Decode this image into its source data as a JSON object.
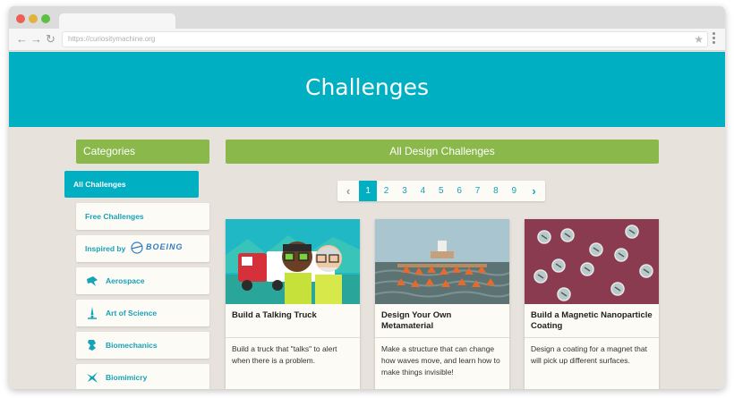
{
  "browser": {
    "url": "https://curiositymachine.org"
  },
  "header": {
    "title": "Challenges"
  },
  "sidebar": {
    "heading": "Categories",
    "items": [
      {
        "label": "All Challenges",
        "active": true,
        "icon": "none"
      },
      {
        "label": "Free Challenges",
        "active": false,
        "icon": "none"
      },
      {
        "label": "Inspired by",
        "active": false,
        "icon": "boeing-logo",
        "logo_text": "BOEING"
      },
      {
        "label": "Aerospace",
        "active": false,
        "icon": "aerospace-icon"
      },
      {
        "label": "Art of Science",
        "active": false,
        "icon": "art-of-science-icon"
      },
      {
        "label": "Biomechanics",
        "active": false,
        "icon": "biomechanics-icon"
      },
      {
        "label": "Biomimicry",
        "active": false,
        "icon": "biomimicry-icon"
      }
    ]
  },
  "main": {
    "heading": "All Design Challenges",
    "pagination": {
      "prev": "‹",
      "next": "›",
      "pages": [
        "1",
        "2",
        "3",
        "4",
        "5",
        "6",
        "7",
        "8",
        "9"
      ],
      "current": "1"
    },
    "cards": [
      {
        "title": "Build a Talking Truck",
        "description": "Build a truck that \"talks\" to alert when there is a problem.",
        "image": "truck-illustration"
      },
      {
        "title": "Design Your Own Metamaterial",
        "description": "Make a structure that can change how waves move, and learn how to make things invisible!",
        "image": "metamaterial-illustration"
      },
      {
        "title": "Build a Magnetic Nanoparticle Coating",
        "description": "Design a coating for a magnet that will pick up different surfaces.",
        "image": "nanoparticle-illustration"
      }
    ]
  },
  "colors": {
    "teal": "#00afc2",
    "green": "#8ab84a",
    "background": "#e7e3dc",
    "card": "#fdfbf6"
  }
}
